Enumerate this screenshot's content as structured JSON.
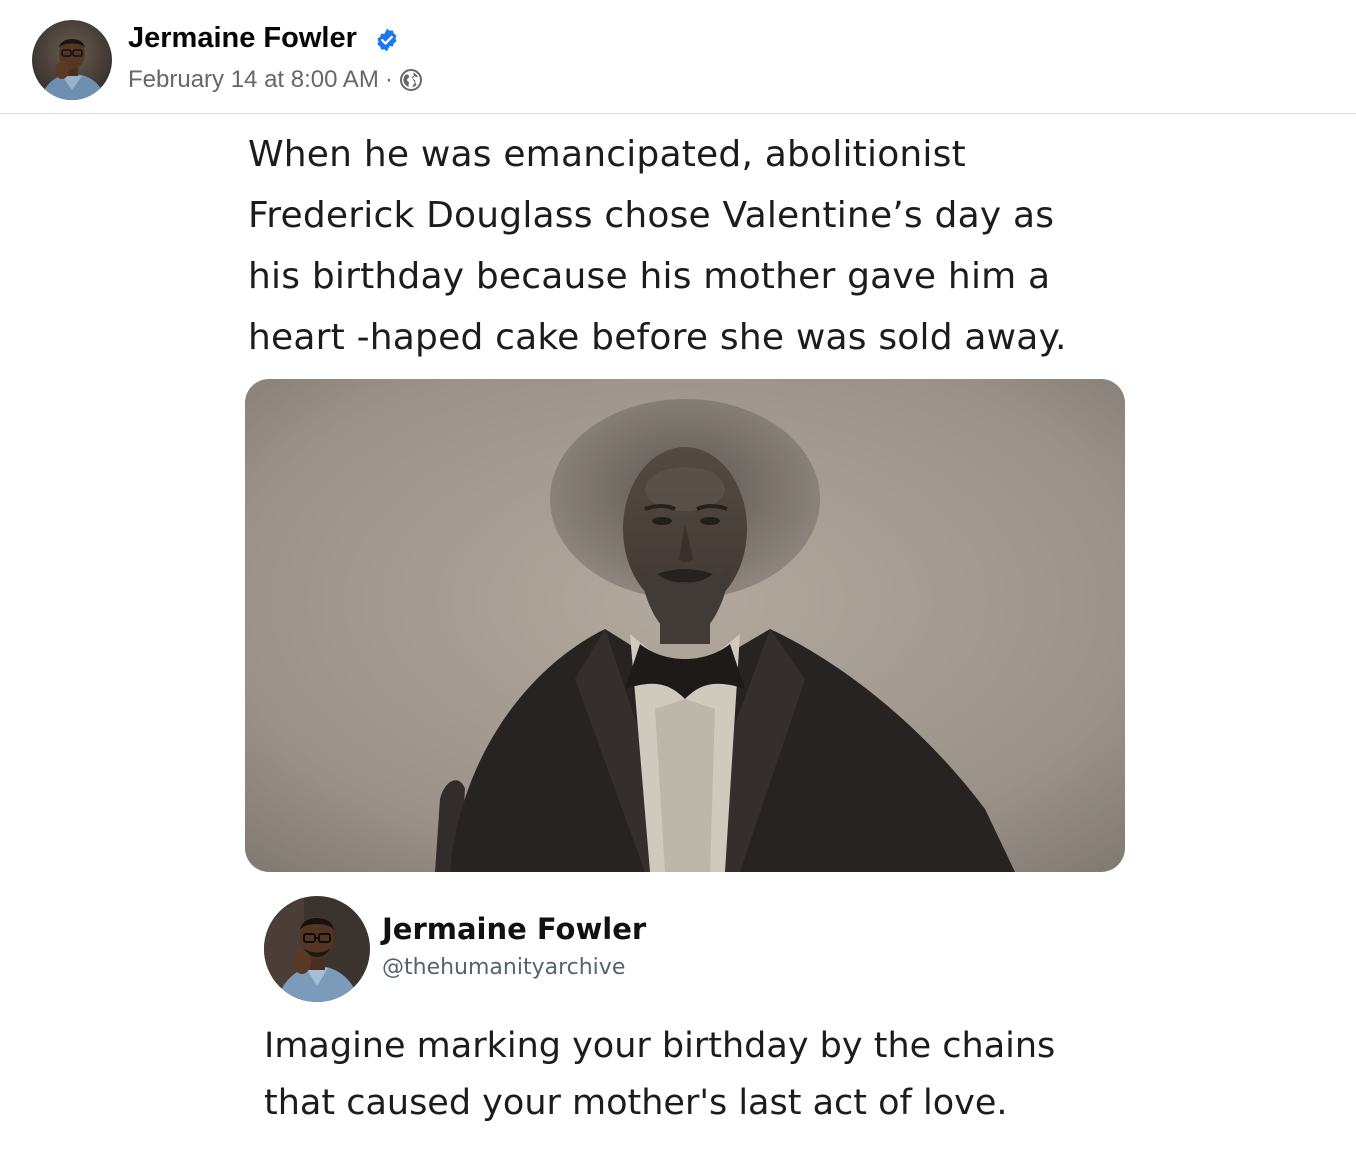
{
  "post": {
    "author": "Jermaine Fowler",
    "verified_icon": "verified-badge-icon",
    "date": "February 14 at 8:00 AM",
    "separator": "·",
    "audience_icon": "globe-icon"
  },
  "shared_image": {
    "caption_lines": [
      "When he was emancipated, abolitionist",
      "Frederick Douglass chose Valentine’s day as",
      "his birthday because his mother gave him a",
      "heart -haped cake before she was sold away."
    ],
    "tweet": {
      "name": "Jermaine Fowler",
      "handle": "@thehumanityarchive",
      "text_lines": [
        "Imagine marking your birthday by the chains",
        "that caused your mother's last act of love."
      ]
    }
  },
  "colors": {
    "accent": "#1877f2",
    "meta_text": "#65676b",
    "divider": "#dadde1"
  }
}
